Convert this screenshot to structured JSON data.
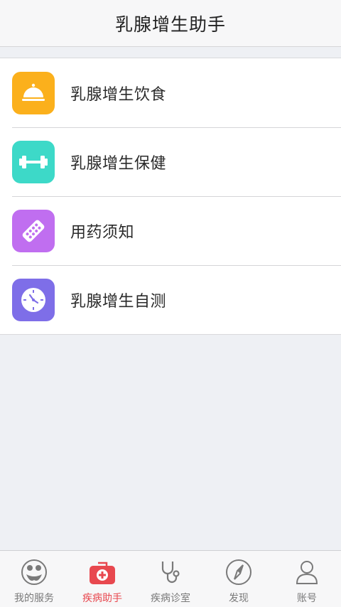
{
  "header": {
    "title": "乳腺增生助手"
  },
  "menu": {
    "items": [
      {
        "label": "乳腺增生饮食",
        "icon": "food-bell-icon",
        "color": "#fbb01c"
      },
      {
        "label": "乳腺增生保健",
        "icon": "dumbbell-icon",
        "color": "#3dd9c8"
      },
      {
        "label": "用药须知",
        "icon": "pill-strip-icon",
        "color": "#c06ef0"
      },
      {
        "label": "乳腺增生自测",
        "icon": "clock-icon",
        "color": "#7e6ee8"
      }
    ]
  },
  "tabbar": {
    "tabs": [
      {
        "label": "我的服务",
        "icon": "service-icon"
      },
      {
        "label": "疾病助手",
        "icon": "medical-kit-icon",
        "active": true
      },
      {
        "label": "疾病诊室",
        "icon": "stethoscope-icon"
      },
      {
        "label": "发现",
        "icon": "compass-icon"
      },
      {
        "label": "账号",
        "icon": "person-icon"
      }
    ],
    "active_color": "#e8484f"
  }
}
